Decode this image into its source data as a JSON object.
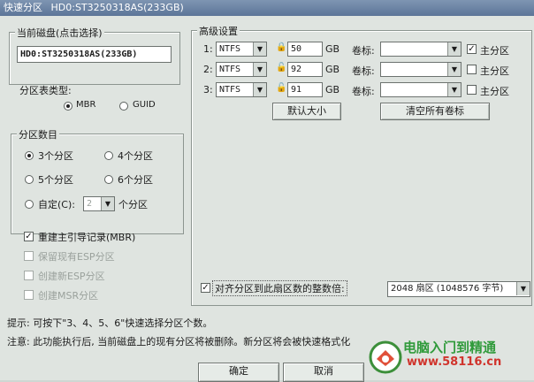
{
  "window": {
    "title": "快速分区",
    "disk_header": "HD0:ST3250318AS(233GB)"
  },
  "current_disk": {
    "label": "当前磁盘(点击选择)",
    "value": "HD0:ST3250318AS(233GB)"
  },
  "partition_table": {
    "label": "分区表类型:",
    "options": [
      {
        "label": "MBR",
        "selected": true
      },
      {
        "label": "GUID",
        "selected": false
      }
    ]
  },
  "partition_count": {
    "label": "分区数目",
    "options": [
      {
        "label": "3个分区",
        "selected": true
      },
      {
        "label": "4个分区",
        "selected": false
      },
      {
        "label": "5个分区",
        "selected": false
      },
      {
        "label": "6个分区",
        "selected": false
      }
    ],
    "custom": {
      "label": "自定(C):",
      "value": "2",
      "suffix": "个分区",
      "selected": false
    }
  },
  "options": {
    "rebuild_mbr": {
      "label": "重建主引导记录(MBR)",
      "checked": true,
      "enabled": true
    },
    "keep_esp": {
      "label": "保留现有ESP分区",
      "checked": false,
      "enabled": false
    },
    "create_esp": {
      "label": "创建新ESP分区",
      "checked": false,
      "enabled": false
    },
    "create_msr": {
      "label": "创建MSR分区",
      "checked": false,
      "enabled": false
    }
  },
  "advanced": {
    "label": "高级设置",
    "rows": [
      {
        "index": "1:",
        "fs": "NTFS",
        "size": "50",
        "unit": "GB",
        "volume_label": "卷标:",
        "volume_value": "",
        "primary_label": "主分区",
        "primary": true
      },
      {
        "index": "2:",
        "fs": "NTFS",
        "size": "92",
        "unit": "GB",
        "volume_label": "卷标:",
        "volume_value": "",
        "primary_label": "主分区",
        "primary": false
      },
      {
        "index": "3:",
        "fs": "NTFS",
        "size": "91",
        "unit": "GB",
        "volume_label": "卷标:",
        "volume_value": "",
        "primary_label": "主分区",
        "primary": false
      }
    ],
    "default_size_button": "默认大小",
    "clear_labels_button": "清空所有卷标"
  },
  "align": {
    "label": "对齐分区到此扇区数的整数倍:",
    "checked": true,
    "value": "2048 扇区 (1048576 字节)"
  },
  "hints": {
    "tip": "提示: 可按下\"3、4、5、6\"快速选择分区个数。",
    "warning": "注意: 此功能执行后, 当前磁盘上的现有分区将被删除。新分区将会被快速格式化"
  },
  "buttons": {
    "ok": "确定",
    "cancel": "取消"
  },
  "watermark": {
    "name": "电脑入门到精通",
    "url": "www.58116.cn"
  }
}
